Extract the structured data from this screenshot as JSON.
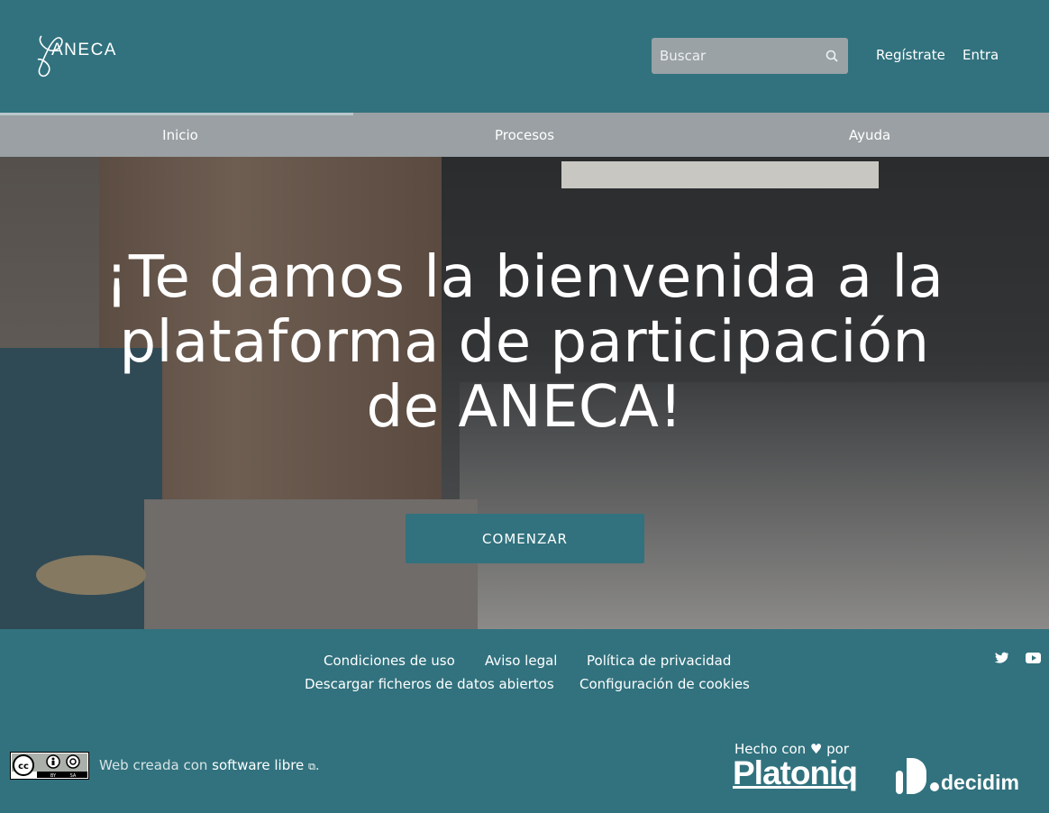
{
  "header": {
    "logo_text": "ANECA",
    "search": {
      "placeholder": "Buscar"
    },
    "register_label": "Regístrate",
    "login_label": "Entra"
  },
  "nav": {
    "items": [
      {
        "label": "Inicio"
      },
      {
        "label": "Procesos"
      },
      {
        "label": "Ayuda"
      }
    ]
  },
  "hero": {
    "title": "¡Te damos la bienvenida a la plataforma de participación de ANECA!",
    "cta_label": "COMENZAR"
  },
  "footer": {
    "links": [
      {
        "label": "Condiciones de uso"
      },
      {
        "label": "Aviso legal"
      },
      {
        "label": "Política de privacidad"
      },
      {
        "label": "Descargar ficheros de datos abiertos"
      },
      {
        "label": "Configuración de cookies"
      }
    ],
    "social": [
      "twitter-icon",
      "youtube-icon"
    ],
    "license_text": "Web creada con",
    "license_link": "software libre",
    "made_by": "Hecho con ♥ por",
    "platoniq": "Platoniq",
    "decidim": "decidim"
  },
  "colors": {
    "primary": "#31727e",
    "nav_bg": "#9aa0a3",
    "search_bg": "#9aa2a6"
  }
}
